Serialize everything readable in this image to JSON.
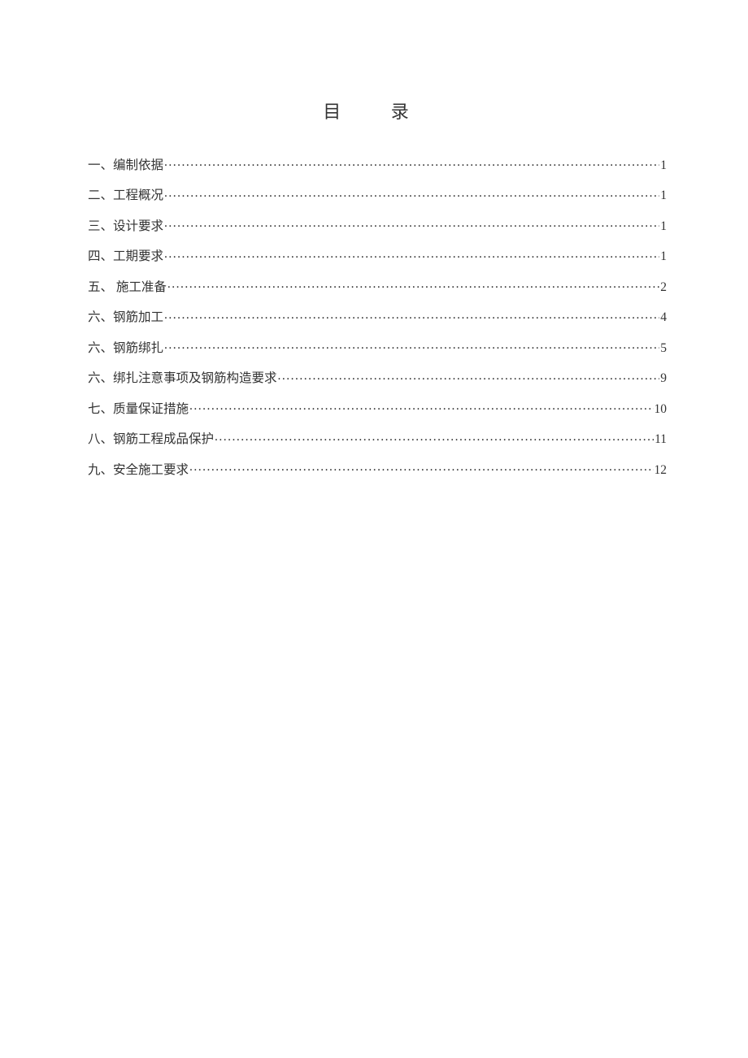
{
  "title": "目 录",
  "toc": [
    {
      "label": "一、编制依据",
      "page": "1"
    },
    {
      "label": "二、工程概况",
      "page": "1"
    },
    {
      "label": "三、设计要求",
      "page": "1"
    },
    {
      "label": "四、工期要求",
      "page": "1"
    },
    {
      "label": "五、 施工准备",
      "page": "2"
    },
    {
      "label": "六、钢筋加工",
      "page": "4"
    },
    {
      "label": "六、钢筋绑扎",
      "page": "5"
    },
    {
      "label": "六、绑扎注意事项及钢筋构造要求",
      "page": "9"
    },
    {
      "label": "七、质量保证措施",
      "page": "10"
    },
    {
      "label": "八、钢筋工程成品保护",
      "page": "11"
    },
    {
      "label": "九、安全施工要求",
      "page": "12"
    }
  ]
}
